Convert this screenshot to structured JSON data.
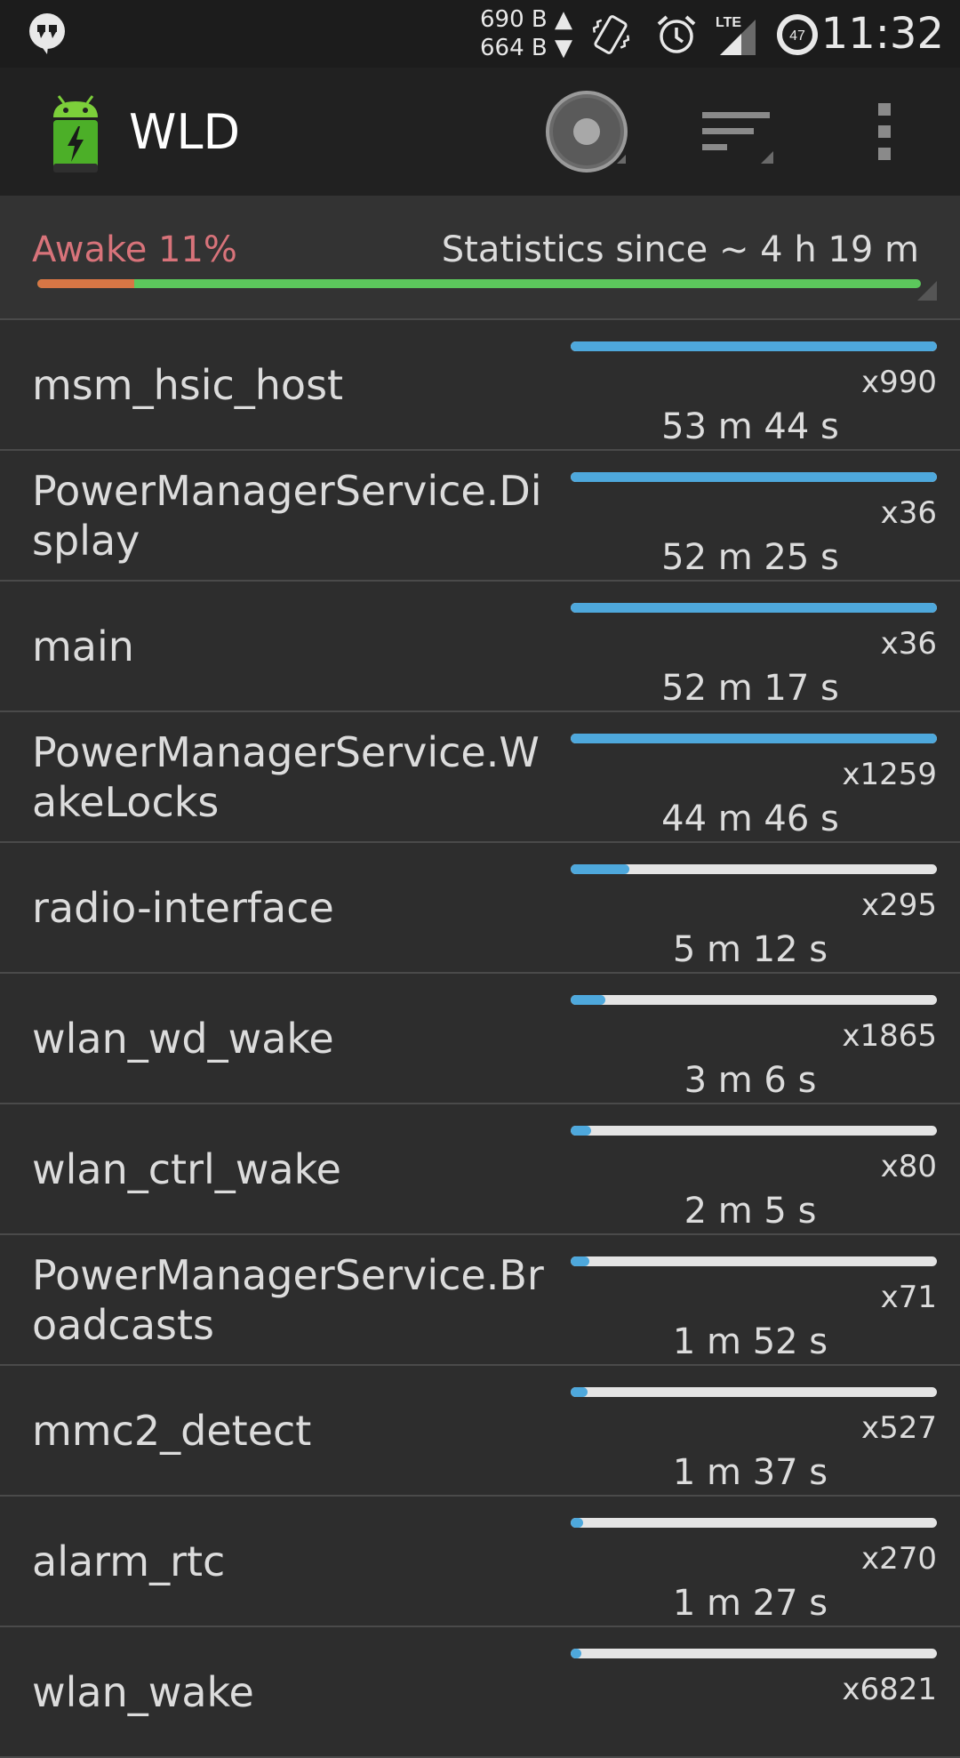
{
  "status_bar": {
    "left_icon": "hangouts-icon",
    "upload_speed": "690 B ▲",
    "download_speed": "664 B ▼",
    "icons": [
      "vibrate-icon",
      "alarm-icon",
      "lte-signal-icon",
      "battery-47-icon"
    ],
    "battery_level": "47",
    "network_label": "LTE",
    "time": "11:32"
  },
  "action_bar": {
    "app_icon": "battery-android-icon",
    "title": "WLD",
    "actions": [
      "record-icon",
      "sort-icon",
      "overflow-menu-icon"
    ]
  },
  "summary": {
    "awake_label": "Awake 11%",
    "awake_fraction": 0.11,
    "stats_since": "Statistics since ~ 4 h 19 m"
  },
  "colors": {
    "awake": "#d87645",
    "asleep": "#5cc85c",
    "bar_fill": "#4ea8dc",
    "bar_track": "#e4e4e4",
    "awake_text": "#d8737a"
  },
  "wakelocks": [
    {
      "name": "msm_hsic_host",
      "count": "x990",
      "duration": "53 m 44 s",
      "fraction": 1.0
    },
    {
      "name": "PowerManagerService.Display",
      "count": "x36",
      "duration": "52 m 25 s",
      "fraction": 1.0
    },
    {
      "name": "main",
      "count": "x36",
      "duration": "52 m 17 s",
      "fraction": 1.0
    },
    {
      "name": "PowerManagerService.WakeLocks",
      "count": "x1259",
      "duration": "44 m 46 s",
      "fraction": 1.0
    },
    {
      "name": "radio-interface",
      "count": "x295",
      "duration": "5 m 12 s",
      "fraction": 0.16
    },
    {
      "name": "wlan_wd_wake",
      "count": "x1865",
      "duration": "3 m 6 s",
      "fraction": 0.095
    },
    {
      "name": "wlan_ctrl_wake",
      "count": "x80",
      "duration": "2 m 5 s",
      "fraction": 0.055
    },
    {
      "name": "PowerManagerService.Broadcasts",
      "count": "x71",
      "duration": "1 m 52 s",
      "fraction": 0.05
    },
    {
      "name": "mmc2_detect",
      "count": "x527",
      "duration": "1 m 37 s",
      "fraction": 0.045
    },
    {
      "name": "alarm_rtc",
      "count": "x270",
      "duration": "1 m 27 s",
      "fraction": 0.035
    },
    {
      "name": "wlan_wake",
      "count": "x6821",
      "duration": "",
      "fraction": 0.03
    }
  ]
}
